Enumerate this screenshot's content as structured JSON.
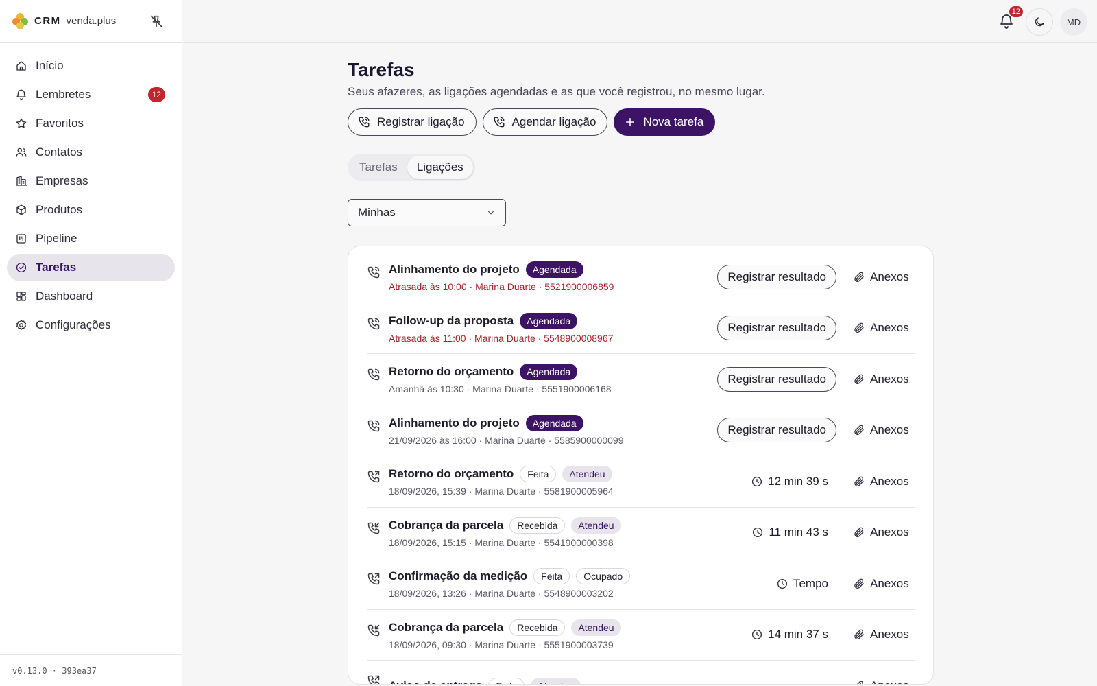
{
  "brand": {
    "name": "CRM",
    "sub": "venda.plus"
  },
  "sidebar": {
    "items": [
      {
        "label": "Início",
        "icon": "home-icon"
      },
      {
        "label": "Lembretes",
        "icon": "bell-icon",
        "badge": "12"
      },
      {
        "label": "Favoritos",
        "icon": "star-icon"
      },
      {
        "label": "Contatos",
        "icon": "users-icon"
      },
      {
        "label": "Empresas",
        "icon": "building-icon"
      },
      {
        "label": "Produtos",
        "icon": "box-icon"
      },
      {
        "label": "Pipeline",
        "icon": "kanban-icon"
      },
      {
        "label": "Tarefas",
        "icon": "check-circle-icon",
        "active": true
      },
      {
        "label": "Dashboard",
        "icon": "dashboard-icon"
      },
      {
        "label": "Configurações",
        "icon": "gear-icon"
      }
    ],
    "version": "v0.13.0 · 393ea37"
  },
  "topbar": {
    "notifications": "12",
    "avatar": "MD"
  },
  "page": {
    "title": "Tarefas",
    "subtitle": "Seus afazeres, as ligações agendadas e as que você registrou, no mesmo lugar.",
    "actions": {
      "register": "Registrar ligação",
      "schedule": "Agendar ligação",
      "new_task": "Nova tarefa"
    },
    "tabs": [
      "Tarefas",
      "Ligações"
    ],
    "active_tab": "Ligações",
    "filter": "Minhas"
  },
  "labels": {
    "result": "Registrar resultado",
    "attachments": "Anexos"
  },
  "colors": {
    "accent": "#3d1366",
    "danger": "#c0262d",
    "late_text": "#a6222a"
  },
  "calls": [
    {
      "title": "Alinhamento do projeto",
      "tags": [
        {
          "text": "Agendada",
          "style": "sched"
        }
      ],
      "meta": "Atrasada às 10:00 · Marina Duarte · 5521900006859",
      "late": true,
      "scheduled": true
    },
    {
      "title": "Follow-up da proposta",
      "tags": [
        {
          "text": "Agendada",
          "style": "sched"
        }
      ],
      "meta": "Atrasada às 11:00 · Marina Duarte · 5548900008967",
      "late": true,
      "scheduled": true
    },
    {
      "title": "Retorno do orçamento",
      "tags": [
        {
          "text": "Agendada",
          "style": "sched"
        }
      ],
      "meta": "Amanhã às 10:30 · Marina Duarte · 5551900006168",
      "late": false,
      "scheduled": true
    },
    {
      "title": "Alinhamento do projeto",
      "tags": [
        {
          "text": "Agendada",
          "style": "sched"
        }
      ],
      "meta": "21/09/2026 às 16:00 · Marina Duarte · 5585900000099",
      "late": false,
      "scheduled": true
    },
    {
      "title": "Retorno do orçamento",
      "tags": [
        {
          "text": "Feita",
          "style": "outline"
        },
        {
          "text": "Atendeu",
          "style": "soft"
        }
      ],
      "meta": "18/09/2026, 15:39 · Marina Duarte · 5581900005964",
      "late": false,
      "scheduled": false,
      "direction": "out",
      "duration": "12 min 39 s"
    },
    {
      "title": "Cobrança da parcela",
      "tags": [
        {
          "text": "Recebida",
          "style": "outline"
        },
        {
          "text": "Atendeu",
          "style": "soft"
        }
      ],
      "meta": "18/09/2026, 15:15 · Marina Duarte · 5541900000398",
      "late": false,
      "scheduled": false,
      "direction": "in",
      "duration": "11 min 43 s"
    },
    {
      "title": "Confirmação da medição",
      "tags": [
        {
          "text": "Feita",
          "style": "outline"
        },
        {
          "text": "Ocupado",
          "style": "outline"
        }
      ],
      "meta": "18/09/2026, 13:26 · Marina Duarte · 5548900003202",
      "late": false,
      "scheduled": false,
      "direction": "out",
      "duration": "Tempo"
    },
    {
      "title": "Cobrança da parcela",
      "tags": [
        {
          "text": "Recebida",
          "style": "outline"
        },
        {
          "text": "Atendeu",
          "style": "soft"
        }
      ],
      "meta": "18/09/2026, 09:30 · Marina Duarte · 5551900003739",
      "late": false,
      "scheduled": false,
      "direction": "in",
      "duration": "14 min 37 s"
    },
    {
      "title": "Aviso de entrega",
      "tags": [
        {
          "text": "Feita",
          "style": "outline"
        },
        {
          "text": "Atendeu",
          "style": "soft"
        }
      ],
      "meta": "",
      "late": false,
      "scheduled": false,
      "direction": "out",
      "duration": ""
    }
  ]
}
